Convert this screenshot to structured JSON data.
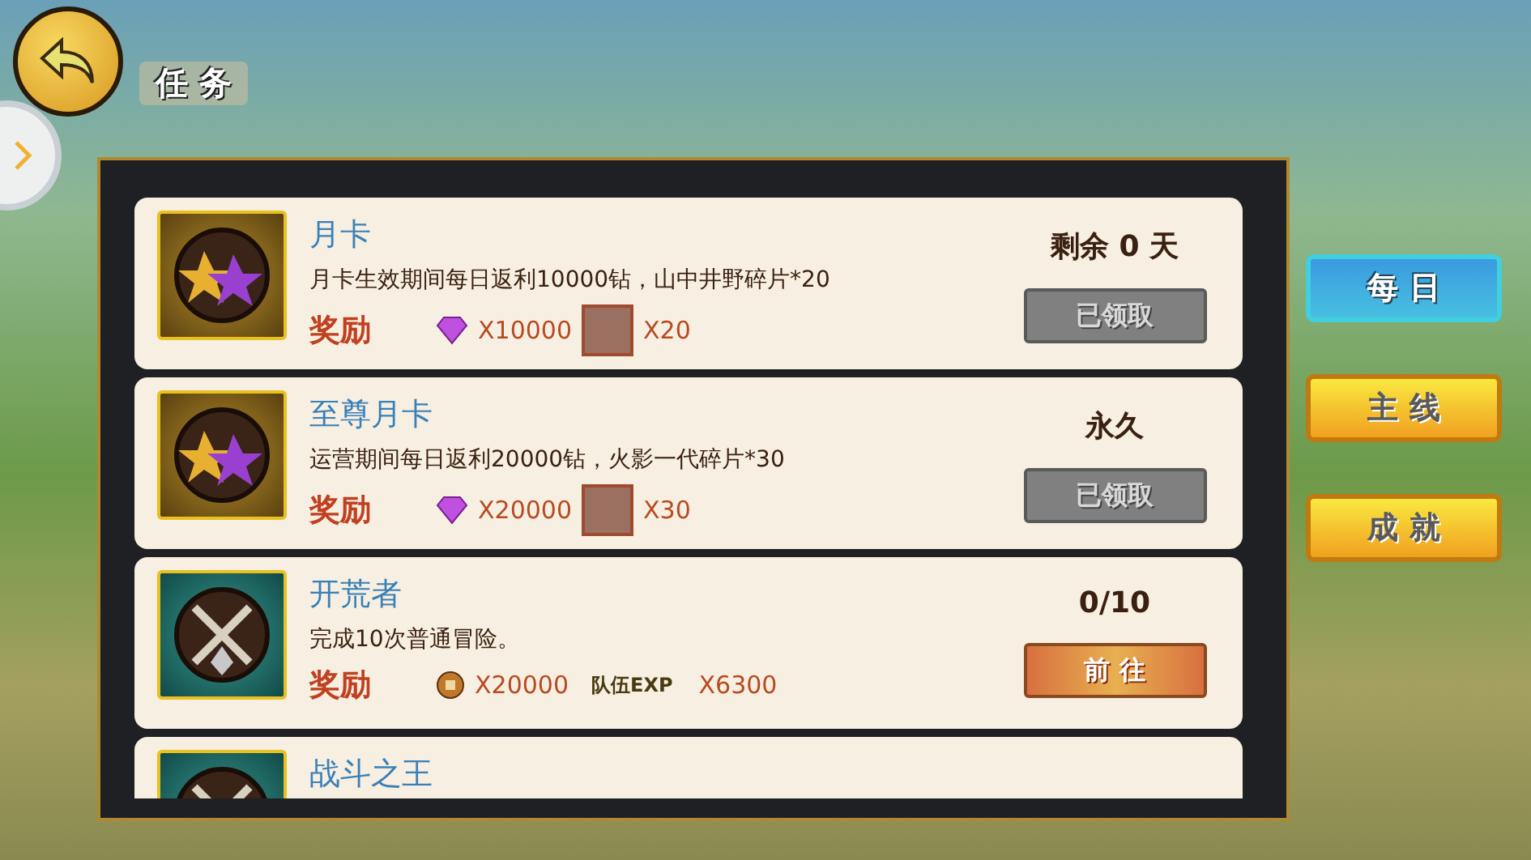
{
  "header": {
    "title": "任 务"
  },
  "tasks": [
    {
      "kind": "card",
      "title": "月卡",
      "description": "月卡生效期间每日返利10000钻，山中井野碎片*20",
      "reward_label": "奖励",
      "rewards": [
        {
          "kind": "gem",
          "amount": "X10000"
        },
        {
          "kind": "portrait",
          "amount": "X20"
        }
      ],
      "status": "剩余 0 天",
      "button": {
        "label": "已领取",
        "disabled": true
      }
    },
    {
      "kind": "card",
      "title": "至尊月卡",
      "description": "运营期间每日返利20000钻，火影一代碎片*30",
      "reward_label": "奖励",
      "rewards": [
        {
          "kind": "gem",
          "amount": "X20000"
        },
        {
          "kind": "portrait",
          "amount": "X30"
        }
      ],
      "status": "永久",
      "button": {
        "label": "已领取",
        "disabled": true
      }
    },
    {
      "kind": "adventure",
      "title": "开荒者",
      "description": "完成10次普通冒险。",
      "reward_label": "奖励",
      "rewards": [
        {
          "kind": "coin",
          "amount": "X20000"
        },
        {
          "kind": "exp",
          "label": "队伍EXP",
          "amount": "X6300"
        }
      ],
      "status": "0/10",
      "button": {
        "label": "前 往",
        "disabled": false
      }
    },
    {
      "kind": "adventure",
      "title": "战斗之王"
    }
  ],
  "tabs": [
    {
      "label": "每 日",
      "selected": true
    },
    {
      "label": "主 线",
      "selected": false
    },
    {
      "label": "成 就",
      "selected": false
    }
  ]
}
